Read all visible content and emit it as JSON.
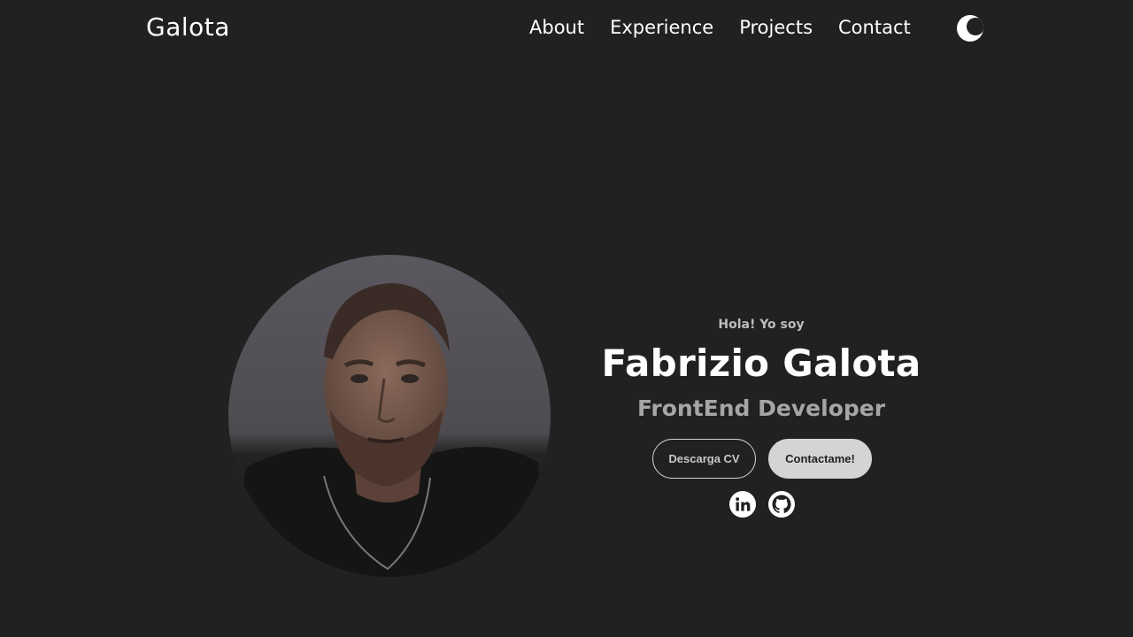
{
  "nav": {
    "logo": "Galota",
    "links": [
      {
        "label": "About"
      },
      {
        "label": "Experience"
      },
      {
        "label": "Projects"
      },
      {
        "label": "Contact"
      }
    ],
    "theme_icon": "moon-icon"
  },
  "hero": {
    "greeting": "Hola! Yo soy",
    "name": "Fabrizio Galota",
    "role": "FrontEnd Developer",
    "buttons": {
      "cv_label": "Descarga CV",
      "contact_label": "Contactame!"
    },
    "socials": [
      {
        "icon": "linkedin-icon"
      },
      {
        "icon": "github-icon"
      }
    ]
  },
  "colors": {
    "background": "#212121",
    "text": "#ffffff",
    "muted": "#a6a6a6",
    "button_fill": "#d4d4d4"
  }
}
